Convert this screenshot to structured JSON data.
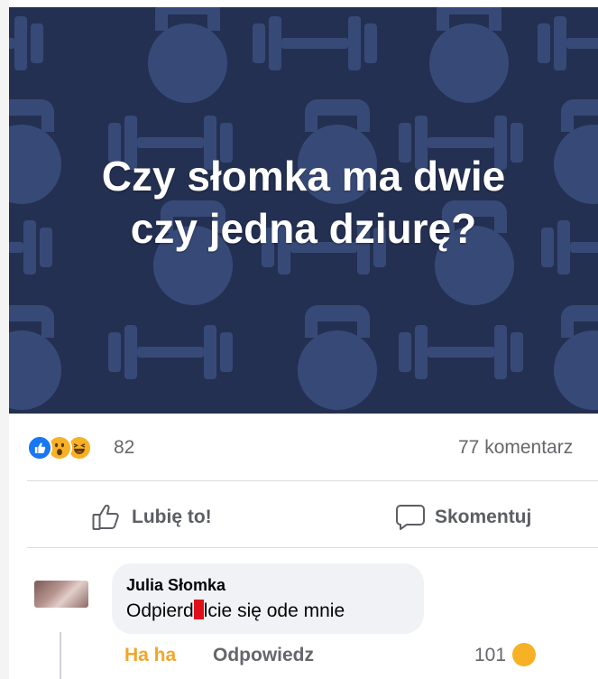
{
  "post": {
    "image_text_line1": "Czy słomka ma dwie",
    "image_text_line2": "czy jedna dziurę?",
    "background_color": "#243052",
    "pattern_color": "#3a4d7c"
  },
  "stats": {
    "reaction_icons": [
      "like-icon",
      "wow-icon",
      "haha-icon"
    ],
    "reaction_count": "82",
    "comment_count": "77 komentarz"
  },
  "actions": {
    "like_label": "Lubię to!",
    "comment_label": "Skomentuj"
  },
  "comment": {
    "author": "Julia Słomka",
    "text_before": "Odpierd",
    "text_after": "lcie się ode mnie",
    "censor_color": "#e0101a",
    "reaction_label": "Ha ha",
    "reply_label": "Odpowiedz",
    "reaction_count": "101"
  }
}
